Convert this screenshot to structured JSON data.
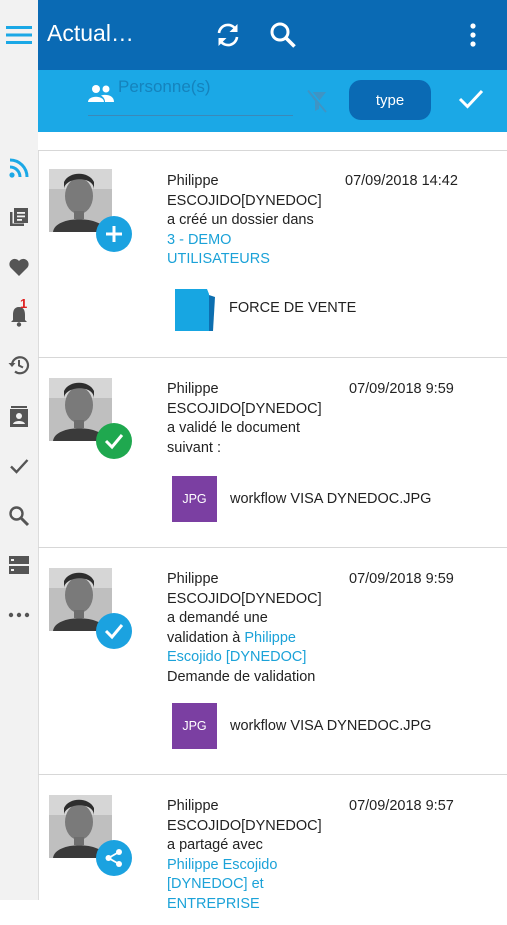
{
  "header": {
    "title": "Actual…"
  },
  "filter": {
    "person_placeholder": "Personne(s)",
    "type_label": "type"
  },
  "rail": {
    "notification_count": "1"
  },
  "feed": [
    {
      "name_line1": "Philippe",
      "name_line2": "ESCOJIDO[DYNEDOC]",
      "action": "a créé un dossier dans",
      "link_line1": "3 - DEMO",
      "link_line2": "UTILISATEURS",
      "date": "07/09/2018 14:42",
      "doc_name": "FORCE DE VENTE",
      "badge": "plus-icon"
    },
    {
      "name_line1": "Philippe",
      "name_line2": "ESCOJIDO[DYNEDOC]",
      "action_line1": "a validé le document",
      "action_line2": "suivant :",
      "date": "07/09/2018 9:59",
      "doc_type": "JPG",
      "doc_name": "workflow VISA DYNEDOC.JPG",
      "badge": "check-icon"
    },
    {
      "name_line1": "Philippe",
      "name_line2": "ESCOJIDO[DYNEDOC]",
      "action_line1": "a demandé une",
      "action_line2_prefix": "validation à",
      "link_line1": "Philippe",
      "link_line2": "Escojido [DYNEDOC]",
      "note": "Demande de validation",
      "date": "07/09/2018 9:59",
      "doc_type": "JPG",
      "doc_name": "workflow VISA DYNEDOC.JPG",
      "badge": "check-icon"
    },
    {
      "name_line1": "Philippe",
      "name_line2": "ESCOJIDO[DYNEDOC]",
      "action": "a partagé avec",
      "link_line1": "Philippe Escojido",
      "link_line2": "[DYNEDOC] et",
      "link_line3": "ENTREPRISE",
      "date": "07/09/2018 9:57",
      "badge": "share-icon"
    }
  ],
  "colors": {
    "topbar": "#0a6ab4",
    "filterbar": "#1ba8e6",
    "link": "#1ba2d8",
    "jpg": "#7b3fa2",
    "folder": "#17a6e2",
    "rail_icon": "#555555",
    "rail_active": "#1ba8e6",
    "badge_green": "#1fa84f",
    "badge_blue": "#1ba2e0"
  }
}
